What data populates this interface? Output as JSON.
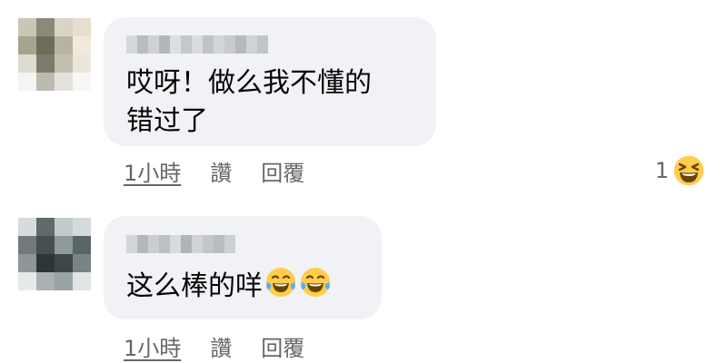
{
  "comments": [
    {
      "text": "哎呀！做么我不懂的\n错过了",
      "time": "1小時",
      "like": "讚",
      "reply": "回覆",
      "reaction_count": "1",
      "reaction_icon": "laughing-squint-emoji-icon"
    },
    {
      "text": "这么棒的咩",
      "emojis": [
        "tears-of-joy-emoji-icon",
        "tears-of-joy-emoji-icon"
      ],
      "time": "1小時",
      "like": "讚",
      "reply": "回覆"
    }
  ],
  "colors": {
    "bubble": "#f0f2f5",
    "text": "#050505",
    "secondary": "#65676b",
    "emoji_yellow": "#ffcc4d",
    "emoji_tear": "#5dadec"
  }
}
